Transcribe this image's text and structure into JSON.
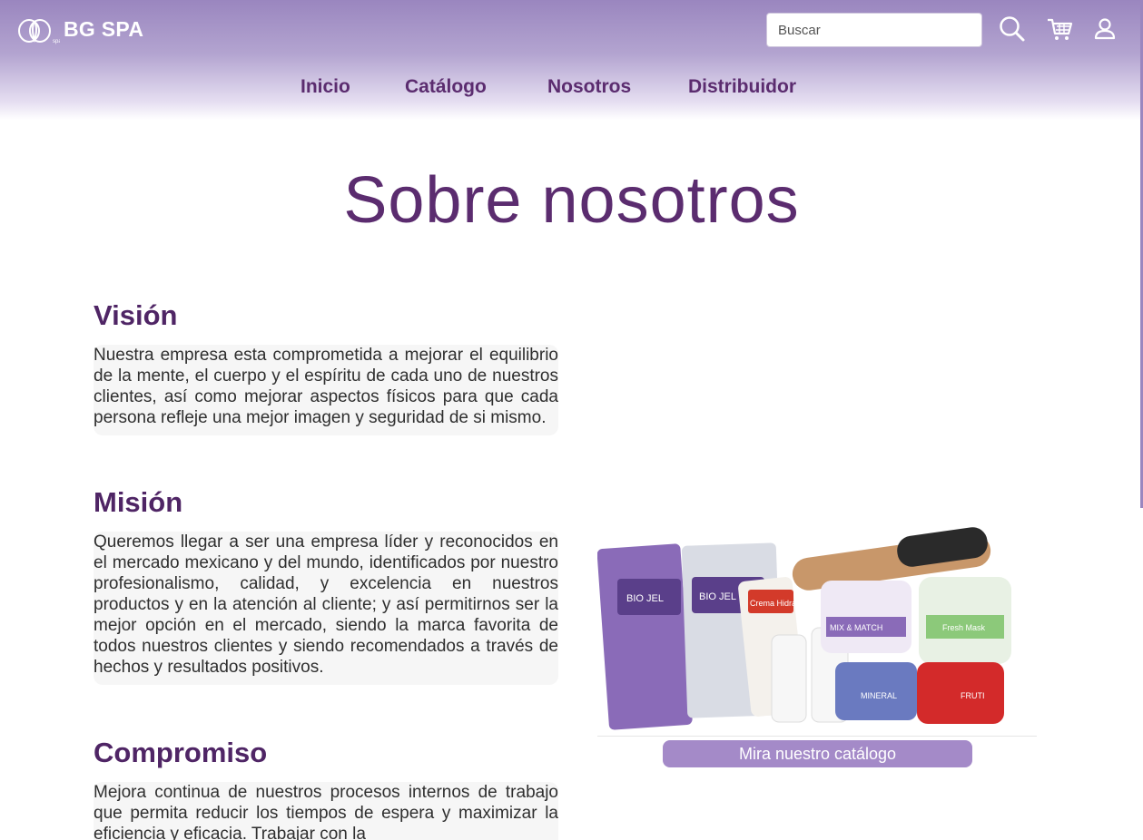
{
  "header": {
    "brand": "BG SPA",
    "search_placeholder": "Buscar"
  },
  "nav": [
    {
      "label": "Inicio"
    },
    {
      "label": "Catálogo"
    },
    {
      "label": "Nosotros"
    },
    {
      "label": "Distribuidor"
    }
  ],
  "page": {
    "title": "Sobre nosotros"
  },
  "sections": [
    {
      "title": "Visión",
      "body": "Nuestra empresa esta comprometida a mejorar el equilibrio de la mente, el cuerpo y el espíritu de cada uno de nuestros clientes, así como mejorar aspectos físicos para que cada persona refleje una mejor imagen y seguridad de si mismo."
    },
    {
      "title": "Misión",
      "body": "Queremos llegar a ser una empresa líder y reconocidos en el mercado mexicano y del mundo, identificados por nuestro profesionalismo, calidad, y excelencia en nuestros productos y en la atención al cliente; y así permitirnos ser la mejor opción en el mercado, siendo la marca favorita de todos nuestros clientes y siendo recomendados a través de hechos y resultados positivos."
    },
    {
      "title": "Compromiso",
      "body": "Mejora continua de nuestros procesos internos de trabajo que permita reducir los tiempos de espera y maximizar la eficiencia y eficacia. Trabajar con la"
    }
  ],
  "promo": {
    "button_label": "Mira nuestro catálogo",
    "product_labels": [
      "BIO JEL",
      "Crema Hidratante",
      "MIX & MATCH",
      "MINERAL",
      "FRUTI",
      "Fresh Mask"
    ]
  },
  "icons": [
    "lotus-logo-icon",
    "search-icon",
    "cart-icon",
    "user-icon"
  ],
  "colors": {
    "brand_purple": "#5b2c6f",
    "header_lavender": "#9a86bf",
    "button": "#a48ac8"
  }
}
